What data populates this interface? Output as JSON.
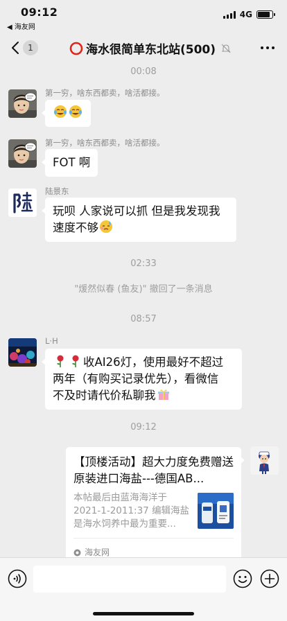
{
  "status_bar": {
    "time": "09:12",
    "back_app": "◀ 海友网",
    "network": "4G",
    "battery_level": 0.85
  },
  "nav": {
    "badge": "1",
    "title": "海水很简单东北站(500)"
  },
  "messages": {
    "time1": "00:08",
    "m1_sender": "第一穷，啥东西都卖，啥活都接。",
    "m2_sender": "第一穷，啥东西都卖，啥活都接。",
    "m2_text": "FOT 啊",
    "m3_sender": "陆景东",
    "m3_line1": "玩呗 人家说可以抓 但是我发现我",
    "m3_line2": "速度不够",
    "time2": "02:33",
    "recall": "\"煖然似春 (鱼友)\" 撤回了一条消息",
    "time3": "08:57",
    "m4_sender": "L·H",
    "m4_line1": "收AI26灯，使用最好不超过",
    "m4_line2": "两年（有购买记录优先），看微信",
    "m4_line3": "不及时请代价私聊我",
    "time4": "09:12",
    "card_title": "【顶楼活动】超大力度免费赠送原装进口海盐---德国AB...",
    "card_desc": "本帖最后由蓝海海洋于 2021-1-2011:37 编辑海盐是海水饲养中最为重要...",
    "card_source": "海友网"
  },
  "input": {
    "placeholder": ""
  },
  "icons": {
    "back": "chevron-left-icon",
    "mute": "mute-bell-icon",
    "more": "more-dots-icon",
    "voice": "voice-icon",
    "emoji": "emoji-icon",
    "plus": "plus-icon"
  },
  "colors": {
    "accent_red": "#e0261c",
    "background": "#ededed",
    "bubble": "#ffffff"
  }
}
